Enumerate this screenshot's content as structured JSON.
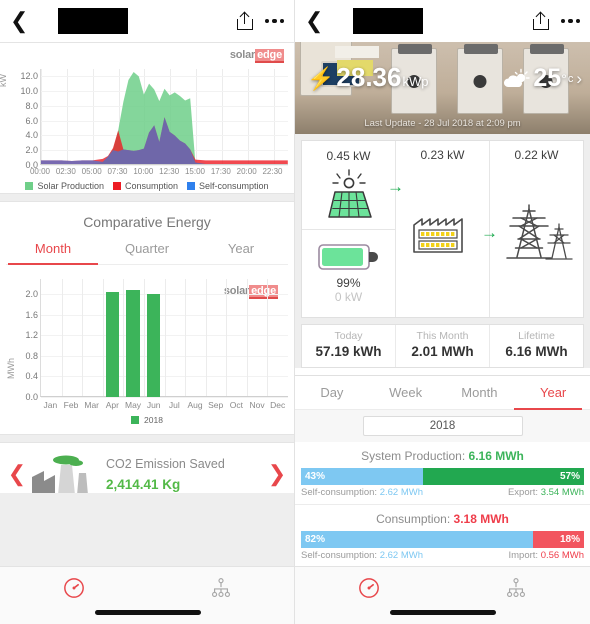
{
  "navbar": {
    "back_icon": "chevron-left-icon",
    "share_icon": "share-icon",
    "more_icon": "more-dots-icon",
    "title_redacted": ""
  },
  "left": {
    "brand": {
      "part1": "solar",
      "part2": "edge"
    },
    "day_chart": {
      "ylabel": "kW",
      "yticks": [
        "12.0",
        "10.0",
        "8.0",
        "6.0",
        "4.0",
        "2.0",
        "0.0"
      ],
      "xticks": [
        "00:00",
        "02:30",
        "05:00",
        "07:30",
        "10:00",
        "12:30",
        "15:00",
        "17:30",
        "20:00",
        "22:30"
      ],
      "legend": [
        {
          "label": "Solar Production",
          "color": "#6fcf89"
        },
        {
          "label": "Consumption",
          "color": "#ed1c24"
        },
        {
          "label": "Self-consumption",
          "color": "#2f80ed"
        }
      ]
    },
    "comparative": {
      "title": "Comparative Energy",
      "tabs": [
        {
          "label": "Month",
          "active": true
        },
        {
          "label": "Quarter",
          "active": false
        },
        {
          "label": "Year",
          "active": false
        }
      ],
      "ylabel": "MWh",
      "legend_year": "2018"
    },
    "co2": {
      "icon": "factory-icon",
      "prev_icon": "chevron-left-icon",
      "next_icon": "chevron-right-icon",
      "label": "CO2 Emission Saved",
      "value": "2,414.41 Kg"
    },
    "tabbar": [
      {
        "icon": "dashboard-gauge-icon",
        "active": true
      },
      {
        "icon": "site-hierarchy-icon",
        "active": false
      }
    ]
  },
  "right": {
    "hero": {
      "bolt_icon": "bolt-icon",
      "peak_power": "28.36",
      "peak_unit": "kWp",
      "weather_icon": "sun-behind-cloud-icon",
      "temperature": "25",
      "degree": "°",
      "temp_unit": "c",
      "chevron": "›",
      "last_update": "Last Update - 28 Jul 2018 at 2:09 pm"
    },
    "flow": {
      "solar_value": "0.45 kW",
      "solar_icon": "solar-panel-icon",
      "house_value": "0.23 kW",
      "house_icon": "building-icon",
      "grid_value": "0.22 kW",
      "grid_icon": "transmission-tower-icon",
      "battery_icon": "battery-icon",
      "battery_percent": "99%",
      "battery_power": "0 kW",
      "arrow": "→"
    },
    "summary": [
      {
        "caption": "Today",
        "value": "57.19 kWh"
      },
      {
        "caption": "This Month",
        "value": "2.01 MWh"
      },
      {
        "caption": "Lifetime",
        "value": "6.16 MWh"
      }
    ],
    "period_tabs": [
      {
        "label": "Day",
        "active": false
      },
      {
        "label": "Week",
        "active": false
      },
      {
        "label": "Month",
        "active": false
      },
      {
        "label": "Year",
        "active": true
      }
    ],
    "year_selector": "2018",
    "production": {
      "title_label": "System Production: ",
      "title_value": "6.16 MWh",
      "left_pct": "43%",
      "right_pct": "57%",
      "left_caption": "Self-consumption: ",
      "left_value": "2.62 MWh",
      "right_caption": "Export: ",
      "right_value": "3.54 MWh"
    },
    "consumption": {
      "title_label": "Consumption: ",
      "title_value": "3.18 MWh",
      "left_pct": "82%",
      "right_pct": "18%",
      "left_caption": "Self-consumption: ",
      "left_value": "2.62 MWh",
      "right_caption": "Import: ",
      "right_value": "0.56 MWh"
    },
    "tabbar": [
      {
        "icon": "dashboard-gauge-icon",
        "active": true
      },
      {
        "icon": "site-hierarchy-icon",
        "active": false
      }
    ]
  },
  "colors": {
    "accent_red": "#e8474b",
    "green": "#3cb45a",
    "green_dark": "#16a84a",
    "blue": "#7ec8f2",
    "red_bar": "#f2555f",
    "grey_text": "#9a9a9a"
  },
  "chart_data": [
    {
      "type": "area",
      "title": "Daily Power",
      "xlabel": "",
      "ylabel": "kW",
      "ylim": [
        0,
        13
      ],
      "grid": true,
      "legend_position": "bottom",
      "x": [
        "00:00",
        "01:00",
        "02:00",
        "03:00",
        "04:00",
        "05:00",
        "06:00",
        "06:30",
        "07:00",
        "07:30",
        "08:00",
        "08:30",
        "09:00",
        "09:30",
        "10:00",
        "10:30",
        "11:00",
        "11:30",
        "12:00",
        "12:30",
        "13:00",
        "13:30",
        "14:00",
        "14:30",
        "15:00",
        "16:00",
        "18:00",
        "20:00",
        "22:00",
        "23:59"
      ],
      "series": [
        {
          "name": "Solar Production",
          "color": "#6fcf89",
          "values": [
            0,
            0,
            0,
            0,
            0,
            0,
            0.3,
            1.0,
            2.0,
            4.6,
            8.5,
            11.5,
            12.6,
            12.0,
            9.5,
            11.0,
            10.2,
            8.6,
            10.3,
            9.4,
            9.8,
            9.3,
            8.7,
            9.0,
            0.2,
            0,
            0,
            0,
            0,
            0
          ]
        },
        {
          "name": "Consumption",
          "color": "#ed1c24",
          "values": [
            0.5,
            0.5,
            0.5,
            0.4,
            0.5,
            0.5,
            0.7,
            1.1,
            2.2,
            4.6,
            2.0,
            1.9,
            1.8,
            1.9,
            2.1,
            4.3,
            5.3,
            3.0,
            6.4,
            4.4,
            3.9,
            3.2,
            2.8,
            2.0,
            0.6,
            0.5,
            0.5,
            0.5,
            0.5,
            0.5
          ]
        },
        {
          "name": "Self-consumption",
          "color": "#2f80ed",
          "values": [
            0.5,
            0.5,
            0.5,
            0.4,
            0.5,
            0.5,
            0.3,
            1.0,
            1.9,
            1.7,
            2.0,
            1.9,
            1.8,
            1.9,
            2.1,
            4.3,
            5.3,
            3.0,
            6.4,
            4.4,
            3.9,
            3.2,
            2.8,
            2.0,
            0.2,
            0,
            0,
            0,
            0,
            0
          ]
        }
      ]
    },
    {
      "type": "bar",
      "title": "Comparative Energy",
      "xlabel": "",
      "ylabel": "MWh",
      "ylim": [
        0,
        2.3
      ],
      "yticks": [
        0.0,
        0.4,
        0.8,
        1.2,
        1.6,
        2.0
      ],
      "grid": true,
      "legend": [
        "2018"
      ],
      "categories": [
        "Jan",
        "Feb",
        "Mar",
        "Apr",
        "May",
        "Jun",
        "Jul",
        "Aug",
        "Sep",
        "Oct",
        "Nov",
        "Dec"
      ],
      "values": [
        0,
        0,
        0,
        2.05,
        2.08,
        2.0,
        0,
        0,
        0,
        0,
        0,
        0
      ],
      "series_color": "#3cb45a"
    },
    {
      "type": "bar",
      "title": "System Production: 6.16 MWh",
      "orientation": "horizontal-stacked",
      "categories": [
        "Self-consumption",
        "Export"
      ],
      "values": [
        2.62,
        3.54
      ],
      "percentages": [
        43,
        57
      ],
      "colors": [
        "#7ec8f2",
        "#22a850"
      ]
    },
    {
      "type": "bar",
      "title": "Consumption: 3.18 MWh",
      "orientation": "horizontal-stacked",
      "categories": [
        "Self-consumption",
        "Import"
      ],
      "values": [
        2.62,
        0.56
      ],
      "percentages": [
        82,
        18
      ],
      "colors": [
        "#7ec8f2",
        "#f2555f"
      ]
    }
  ]
}
